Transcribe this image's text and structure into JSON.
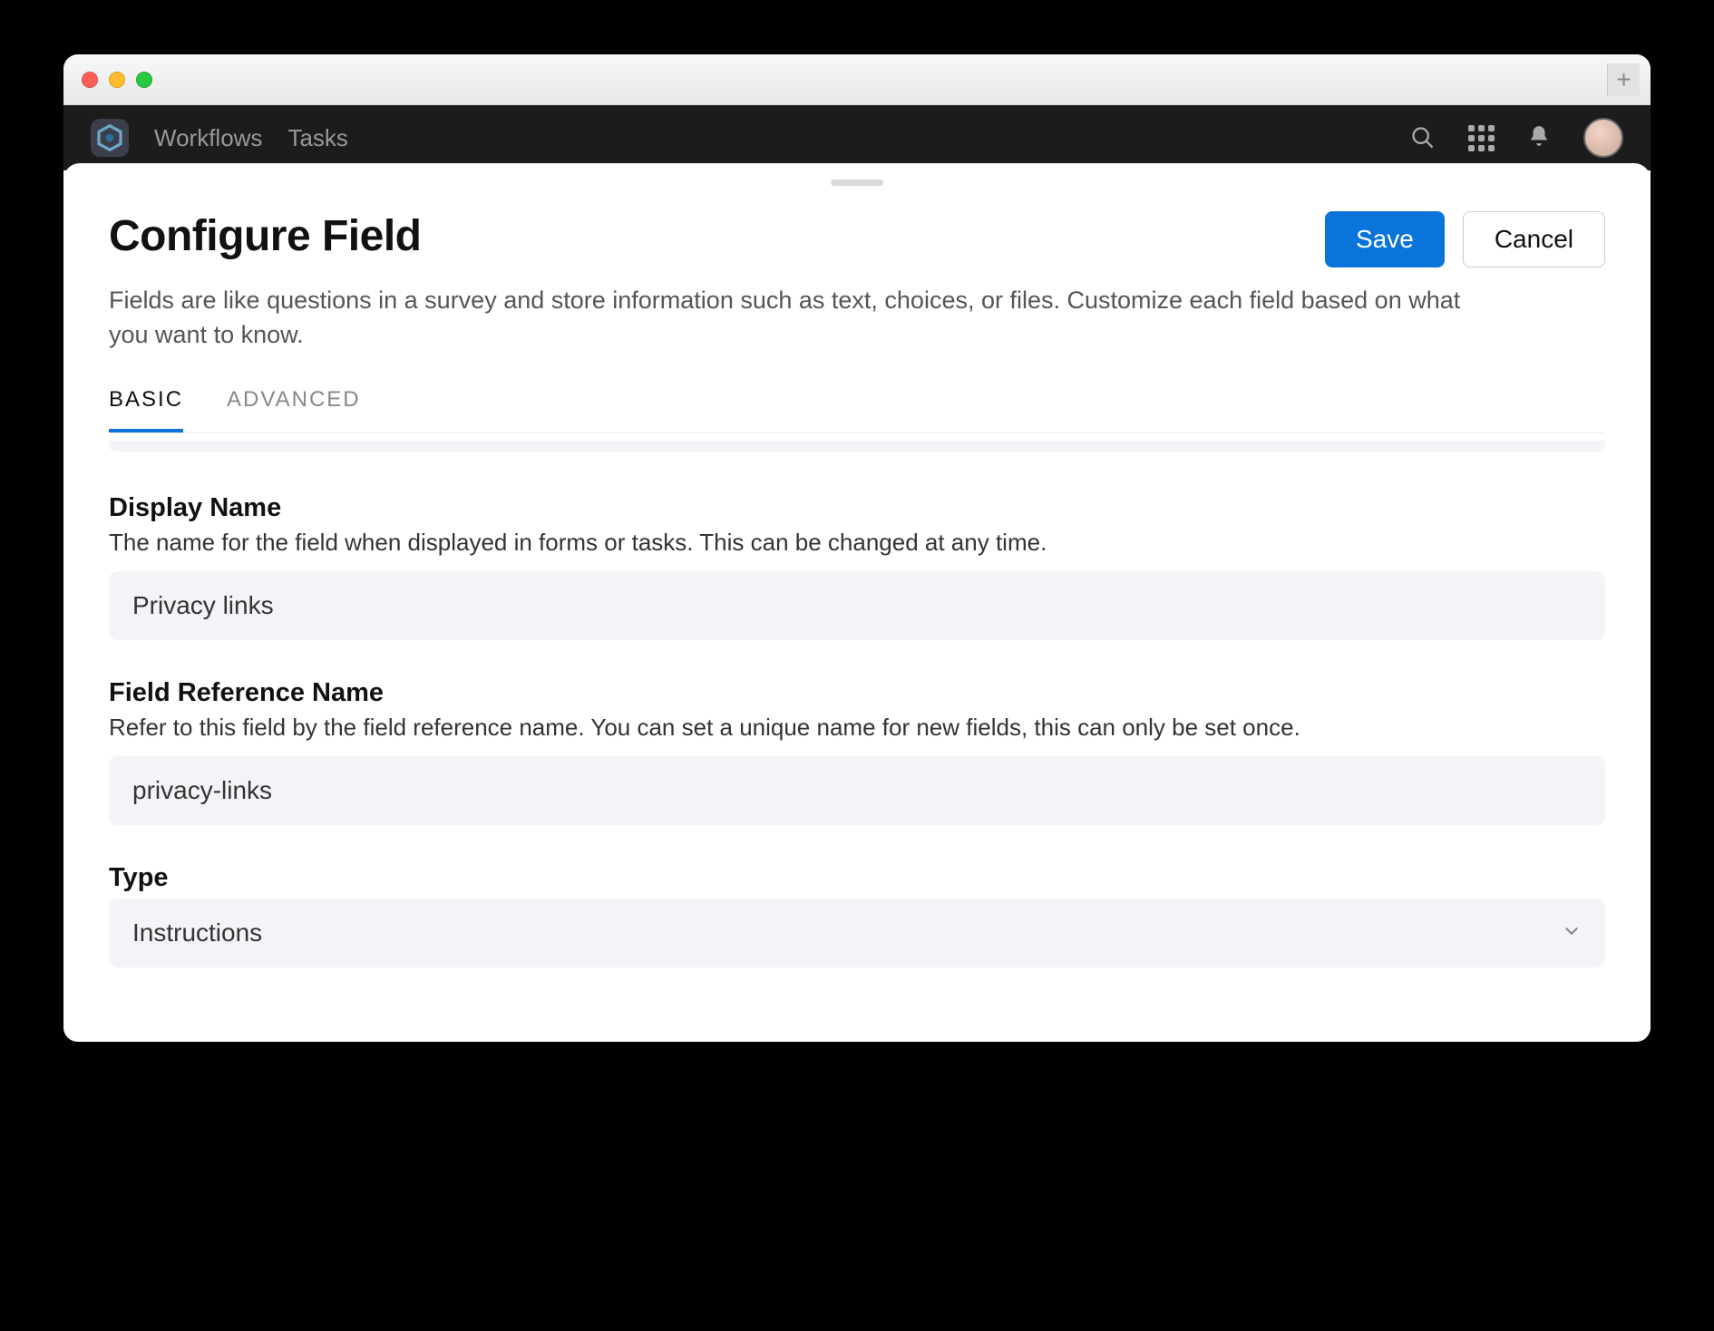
{
  "nav": {
    "workflows": "Workflows",
    "tasks": "Tasks"
  },
  "modal": {
    "title": "Configure Field",
    "description": "Fields are like questions in a survey and store information such as text, choices, or files. Customize each field based on what you want to know.",
    "save_label": "Save",
    "cancel_label": "Cancel",
    "tabs": {
      "basic": "BASIC",
      "advanced": "ADVANCED"
    },
    "fields": {
      "display_name": {
        "label": "Display Name",
        "hint": "The name for the field when displayed in forms or tasks. This can be changed at any time.",
        "value": "Privacy links"
      },
      "reference_name": {
        "label": "Field Reference Name",
        "hint": "Refer to this field by the field reference name. You can set a unique name for new fields, this can only be set once.",
        "value": "privacy-links"
      },
      "type": {
        "label": "Type",
        "value": "Instructions"
      }
    }
  }
}
